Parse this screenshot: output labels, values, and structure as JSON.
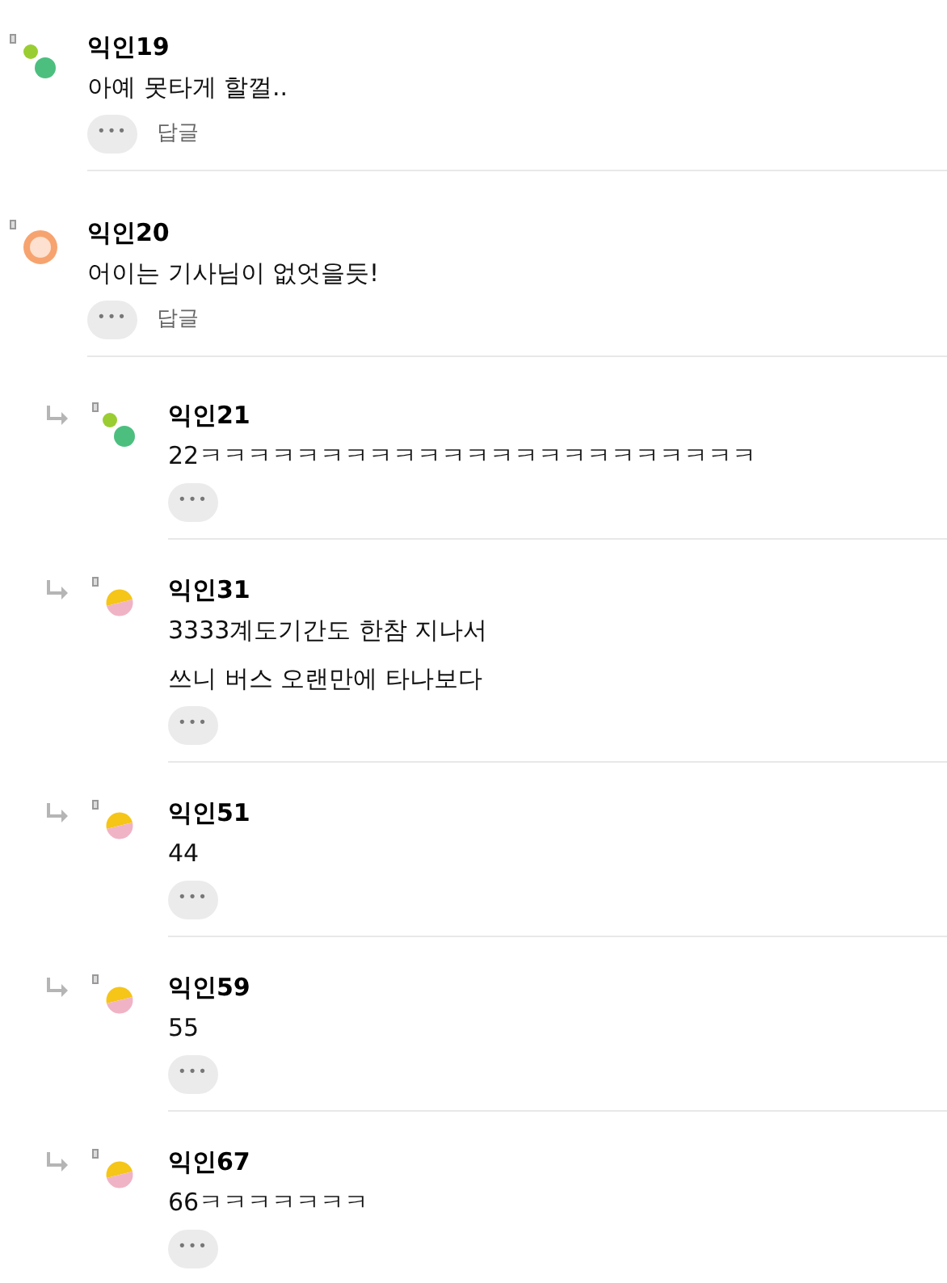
{
  "comments": [
    {
      "author": "익인19",
      "kind": "dots",
      "lines": [
        "아예 못타게 할껄.."
      ],
      "more": "•••",
      "reply": "답글"
    },
    {
      "author": "익인20",
      "kind": "ring",
      "lines": [
        "어이는 기사님이 없엇을듯!"
      ],
      "more": "•••",
      "reply": "답글",
      "children": [
        {
          "author": "익인21",
          "kind": "dots",
          "lines": [
            "22ㅋㅋㅋㅋㅋㅋㅋㅋㅋㅋㅋㅋㅋㅋㅋㅋㅋㅋㅋㅋㅋㅋㅋ"
          ],
          "more": "•••"
        },
        {
          "author": "익인31",
          "kind": "half",
          "lines": [
            "3333계도기간도 한참 지나서",
            "쓰니 버스 오랜만에 타나보다"
          ],
          "more": "•••"
        },
        {
          "author": "익인51",
          "kind": "half",
          "lines": [
            "44"
          ],
          "more": "•••"
        },
        {
          "author": "익인59",
          "kind": "half",
          "lines": [
            "55"
          ],
          "more": "•••"
        },
        {
          "author": "익인67",
          "kind": "half",
          "lines": [
            "66ㅋㅋㅋㅋㅋㅋㅋ"
          ],
          "more": "•••"
        }
      ]
    }
  ]
}
